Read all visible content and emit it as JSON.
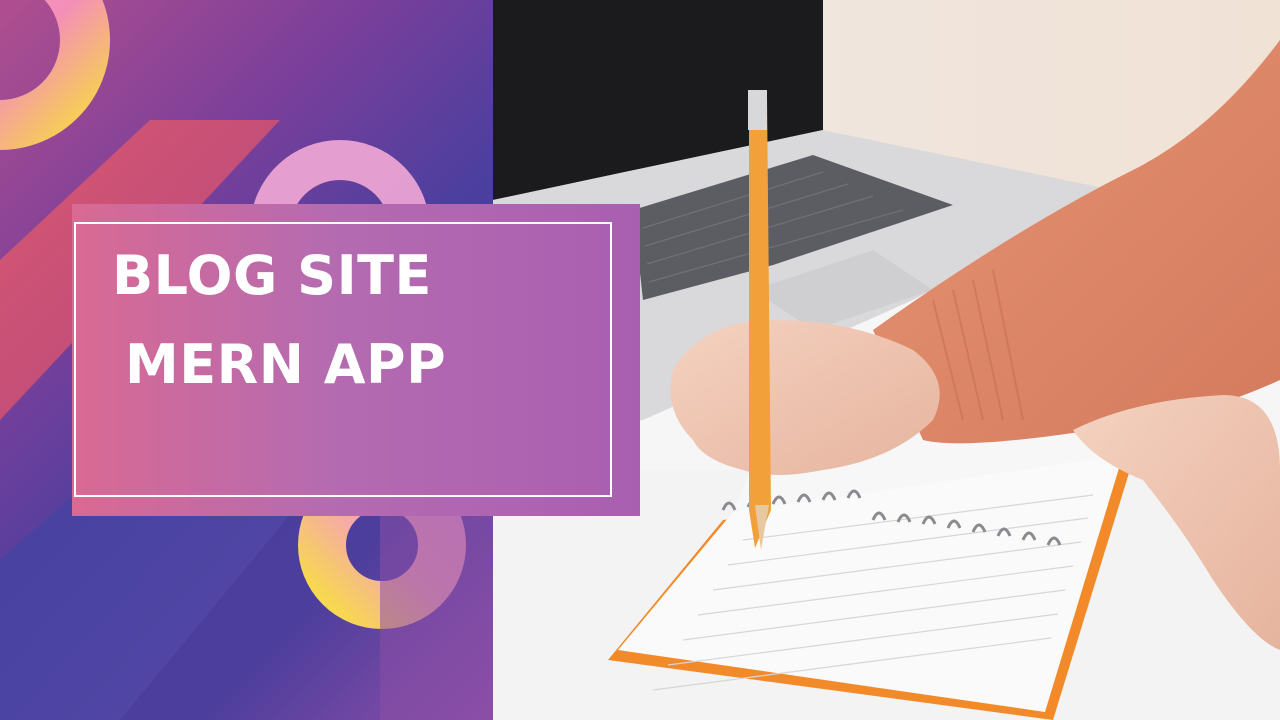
{
  "banner": {
    "title_line_1": "BLOG SITE",
    "title_line_2": "MERN APP"
  },
  "colors": {
    "title_text": "#ffffff",
    "title_box_start": "#d96a93",
    "title_box_end": "#a95fb0",
    "panel_purple": "#4a3f9f",
    "accent_yellow": "#f7d54a",
    "accent_pink": "#f29ac4",
    "sweater": "#e08a6a",
    "pencil": "#f2a03a"
  }
}
